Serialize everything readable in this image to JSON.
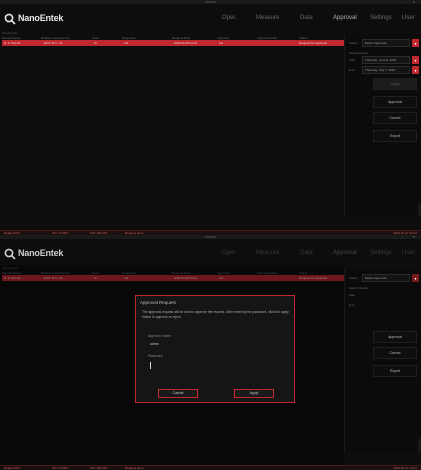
{
  "app": {
    "window_title": "EVO-Tc",
    "logo_text": "NanoEntek",
    "nav": [
      "Oper.",
      "Measure",
      "Data",
      "Approval",
      "Settings",
      "User"
    ],
    "active_nav": "Approval",
    "tab_label": "Pending list",
    "columns": [
      "Sample Name",
      "Related Cassette Key",
      "Tests",
      "Requester",
      "Request Date",
      "Approver",
      "Approved Date",
      "Status"
    ],
    "row": [
      "N. F. Test 01",
      "EVO-Tc 1 - 01",
      "Tc",
      "Ltd",
      "2021.01.05 11:31",
      "Ltd",
      "",
      "Request for Approval"
    ],
    "sidebar": {
      "search_label": "Status",
      "status_value": "Before Approval",
      "period_label": "Search Period",
      "start_label": "Start",
      "start_value": "Thursday, June 9, 2022",
      "end_label": "End",
      "end_value": "Thursday, July 7, 2022",
      "apply_label": "Apply",
      "approval_label": "Approval",
      "cancel_label": "Cancel",
      "export_label": "Export"
    },
    "footer": [
      "Ready EVO",
      "Port: COM3",
      "S/N: 181-001",
      "Request done"
    ],
    "footer_right": "2022-07-07 13:22"
  },
  "modal": {
    "title": "Approval Request",
    "text": "The approval request will be sent to approve the request. After entering the password, click the apply button to approve or reject.",
    "approver_label": "Approver Name",
    "approver_value": "admin",
    "password_label": "Password",
    "cancel_label": "Cancel",
    "ok_label": "Apply"
  },
  "colors": {
    "accent": "#c0282f",
    "background": "#0d0d0d"
  },
  "icons": {
    "logo": "nanoentek-logo-icon",
    "dropdown": "chevron-down-icon"
  }
}
